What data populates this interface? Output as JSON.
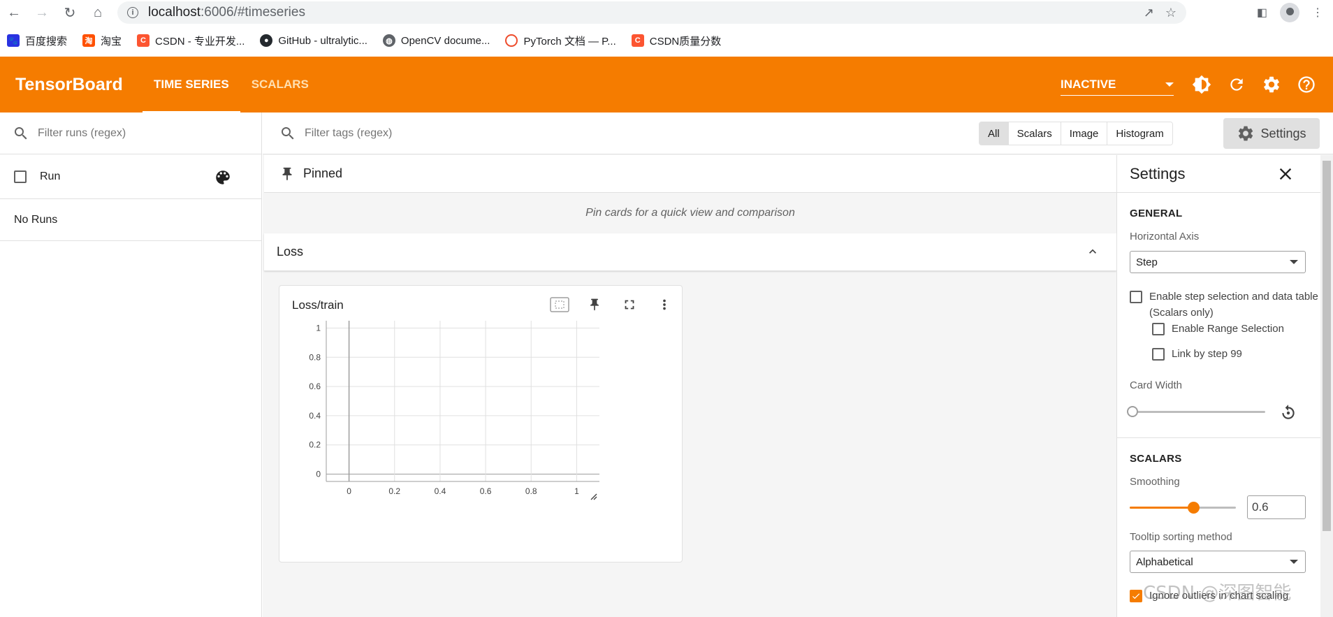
{
  "browser": {
    "url_host": "localhost",
    "url_path": ":6006/#timeseries",
    "bookmarks": [
      {
        "label": "百度搜索",
        "icon": "baidu-icon",
        "color": "#2932e1"
      },
      {
        "label": "淘宝",
        "icon": "taobao-icon",
        "color": "#ff5000"
      },
      {
        "label": "CSDN - 专业开发...",
        "icon": "csdn-icon",
        "color": "#fc5531"
      },
      {
        "label": "GitHub - ultralytic...",
        "icon": "github-icon",
        "color": "#24292e"
      },
      {
        "label": "OpenCV docume...",
        "icon": "globe-icon",
        "color": "#5f6368"
      },
      {
        "label": "PyTorch 文档 — P...",
        "icon": "pytorch-icon",
        "color": "#ee4c2c"
      },
      {
        "label": "CSDN质量分数",
        "icon": "csdn-icon",
        "color": "#fc5531"
      }
    ]
  },
  "header": {
    "brand": "TensorBoard",
    "tabs": [
      {
        "label": "TIME SERIES",
        "active": true
      },
      {
        "label": "SCALARS",
        "active": false
      }
    ],
    "run_state": "INACTIVE",
    "accent": "#f57c00"
  },
  "runs": {
    "filter_placeholder": "Filter runs (regex)",
    "header_label": "Run",
    "empty_text": "No Runs"
  },
  "main": {
    "tag_filter_placeholder": "Filter tags (regex)",
    "type_filters": [
      {
        "label": "All",
        "active": true
      },
      {
        "label": "Scalars"
      },
      {
        "label": "Image"
      },
      {
        "label": "Histogram"
      }
    ],
    "settings_button": "Settings",
    "pinned_title": "Pinned",
    "pinned_empty": "Pin cards for a quick view and comparison",
    "group_title": "Loss"
  },
  "card": {
    "title": "Loss/train",
    "chart_data": {
      "type": "line",
      "x": [],
      "series": [],
      "xticks": [
        "0",
        "0.2",
        "0.4",
        "0.6",
        "0.8",
        "1"
      ],
      "yticks": [
        "0",
        "0.2",
        "0.4",
        "0.6",
        "0.8",
        "1"
      ],
      "xlim": [
        -0.1,
        1.1
      ],
      "ylim": [
        -0.05,
        1.05
      ],
      "grid": true
    }
  },
  "settings": {
    "title": "Settings",
    "general_heading": "GENERAL",
    "horizontal_axis_label": "Horizontal Axis",
    "horizontal_axis_value": "Step",
    "step_selection_label": "Enable step selection and data table",
    "step_selection_sub": "(Scalars only)",
    "range_selection_label": "Enable Range Selection",
    "link_by_step_label": "Link by step 99",
    "card_width_label": "Card Width",
    "card_width_value": 0.0,
    "scalars_heading": "SCALARS",
    "smoothing_label": "Smoothing",
    "smoothing_value": "0.6",
    "smoothing_fraction": 0.6,
    "tooltip_label": "Tooltip sorting method",
    "tooltip_value": "Alphabetical",
    "ignore_outliers_label": "Ignore outliers in chart scaling"
  },
  "watermark": "CSDN @深图智能"
}
